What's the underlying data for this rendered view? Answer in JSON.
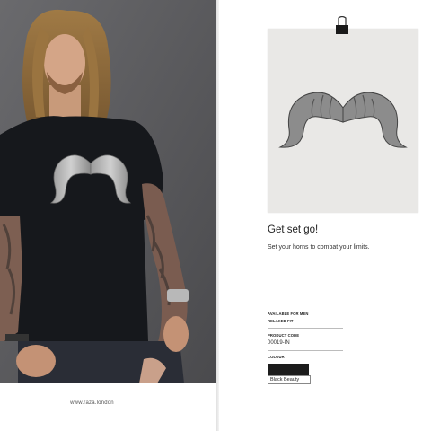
{
  "left_page": {
    "website": "www.raza.london"
  },
  "right_page": {
    "headline": "Get set go!",
    "subline": "Set your horns to combat your limits.",
    "specs": {
      "availability": "AVAILABLE FOR MEN",
      "fit": "RELAXED FIT",
      "product_code_label": "PRODUCT CODE",
      "product_code": "00019-IN",
      "colour_label": "COLOUR",
      "colour_name": "Black Beauty",
      "colour_hex": "#1c1c1c"
    }
  },
  "colors": {
    "wall": "#5b5b5d",
    "shirt": "#16181c",
    "paper": "#e9e8e6"
  },
  "icons": [
    "binder-clip-icon",
    "ram-horns-mustache-graphic"
  ]
}
